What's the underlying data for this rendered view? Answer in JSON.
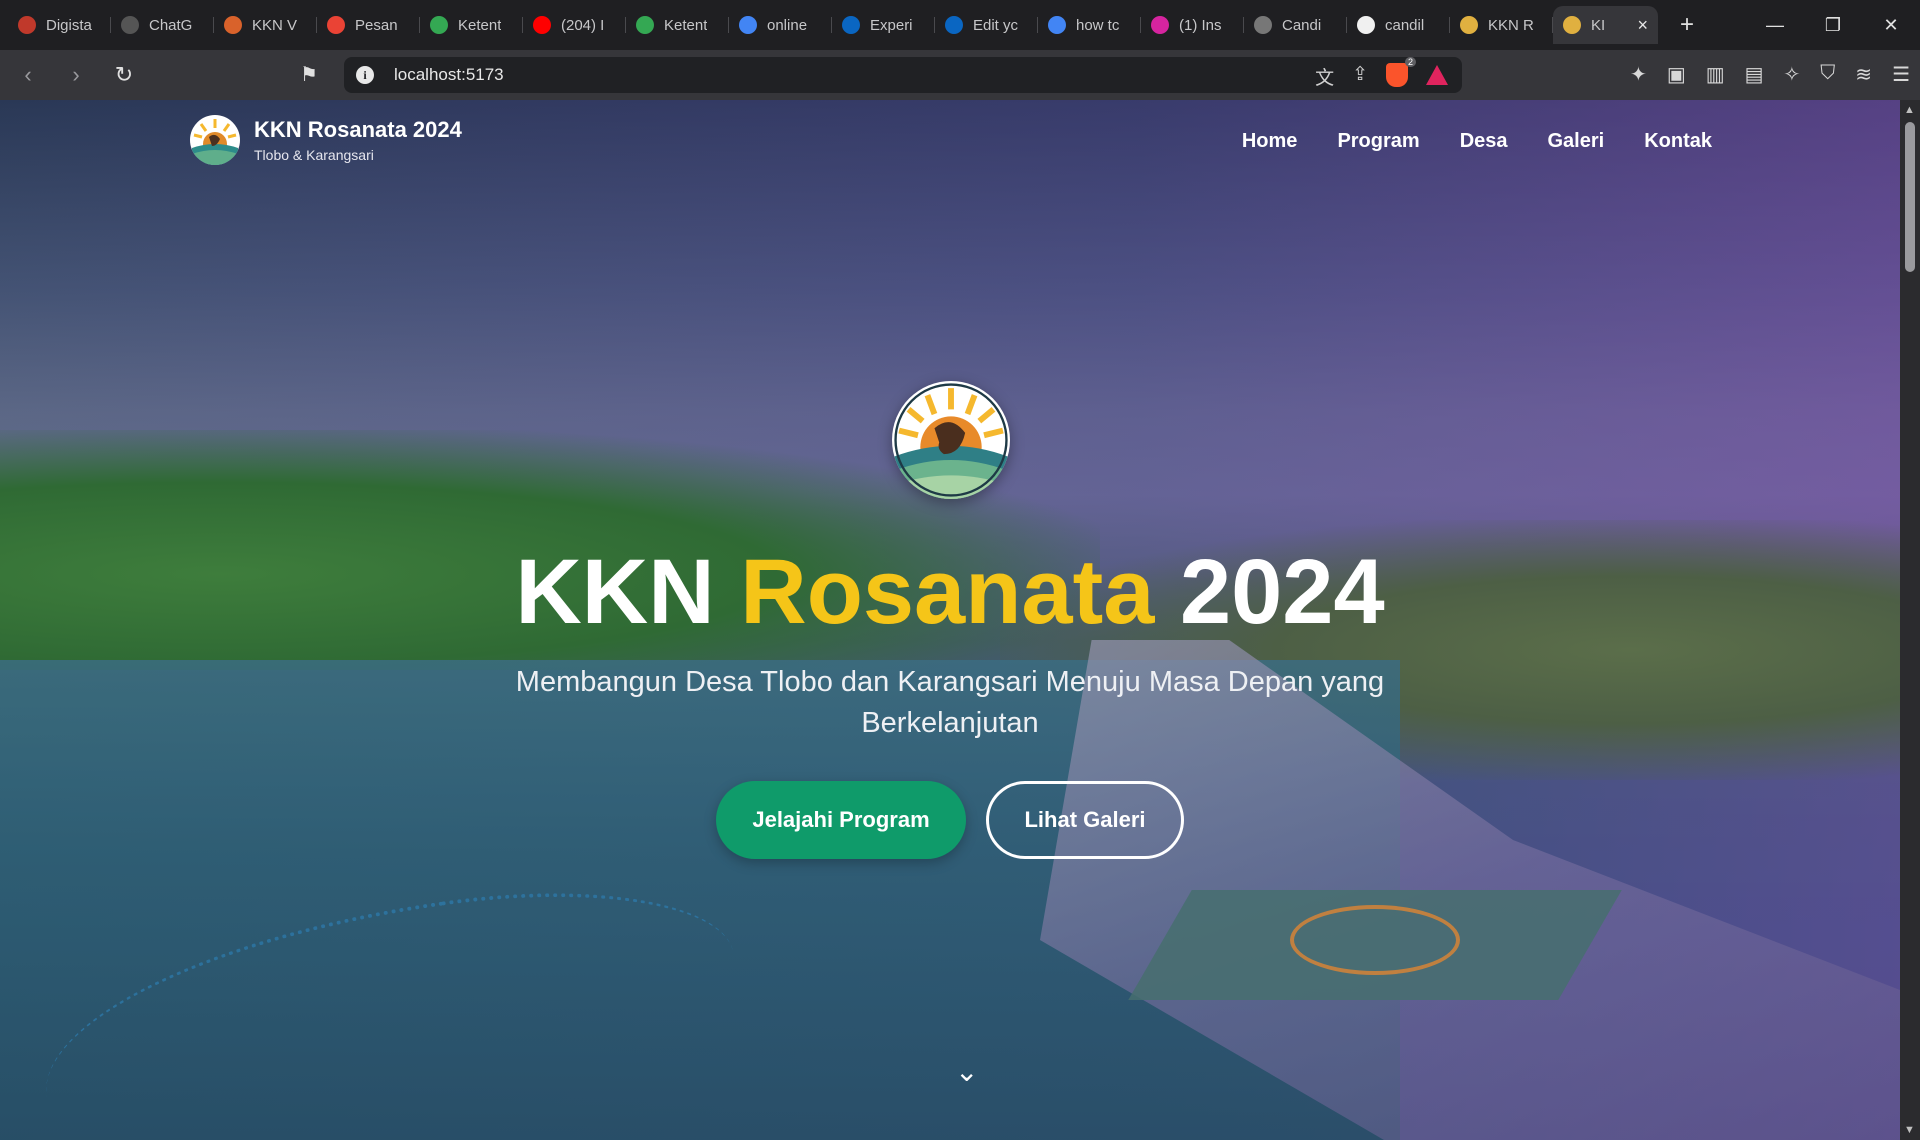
{
  "tabs": [
    {
      "title": "Digista",
      "fav_color": "#c0392b",
      "icon": "digista-icon"
    },
    {
      "title": "ChatG",
      "fav_color": "#555555",
      "icon": "chatgpt-icon"
    },
    {
      "title": "KKN V",
      "fav_color": "#d9622b",
      "icon": "claude-icon"
    },
    {
      "title": "Pesan",
      "fav_color": "#ea4335",
      "icon": "gmail-icon"
    },
    {
      "title": "Ketent",
      "fav_color": "#34a853",
      "icon": "google-drive-icon"
    },
    {
      "title": "(204) I",
      "fav_color": "#ff0000",
      "icon": "youtube-icon"
    },
    {
      "title": "Ketent",
      "fav_color": "#34a853",
      "icon": "google-drive-icon"
    },
    {
      "title": "online",
      "fav_color": "#4285f4",
      "icon": "google-icon"
    },
    {
      "title": "Experi",
      "fav_color": "#0a66c2",
      "icon": "linkedin-icon"
    },
    {
      "title": "Edit yc",
      "fav_color": "#0a66c2",
      "icon": "linkedin-icon"
    },
    {
      "title": "how tc",
      "fav_color": "#4285f4",
      "icon": "google-icon"
    },
    {
      "title": "(1) Ins",
      "fav_color": "#d6249f",
      "icon": "instagram-icon"
    },
    {
      "title": "Candi",
      "fav_color": "#777777",
      "icon": "globe-icon"
    },
    {
      "title": "candil",
      "fav_color": "#f0f0f0",
      "icon": "github-icon"
    },
    {
      "title": "KKN R",
      "fav_color": "#e0b040",
      "icon": "kkn-logo-icon"
    }
  ],
  "active_tab": {
    "title": "KI",
    "close": "×"
  },
  "new_tab": "+",
  "window_controls": {
    "minimize": "—",
    "restore": "❐",
    "close": "✕"
  },
  "toolbar": {
    "back": "‹",
    "forward": "›",
    "reload": "↻",
    "bookmark": "⚑",
    "info": "i",
    "url": "localhost:5173",
    "brave_badge": "2"
  },
  "site": {
    "brand_title": "KKN Rosanata 2024",
    "brand_subtitle": "Tlobo & Karangsari",
    "nav": [
      "Home",
      "Program",
      "Desa",
      "Galeri",
      "Kontak"
    ]
  },
  "hero": {
    "title_part1": "KKN",
    "title_accent": "Rosanata",
    "title_part2": "2024",
    "subtitle": "Membangun Desa Tlobo dan Karangsari Menuju Masa Depan yang Berkelanjutan",
    "primary_button": "Jelajahi Program",
    "secondary_button": "Lihat Galeri",
    "scroll_indicator": "⌄"
  },
  "colors": {
    "accent_yellow": "#f5c518",
    "primary_green": "#0f9b6a"
  }
}
